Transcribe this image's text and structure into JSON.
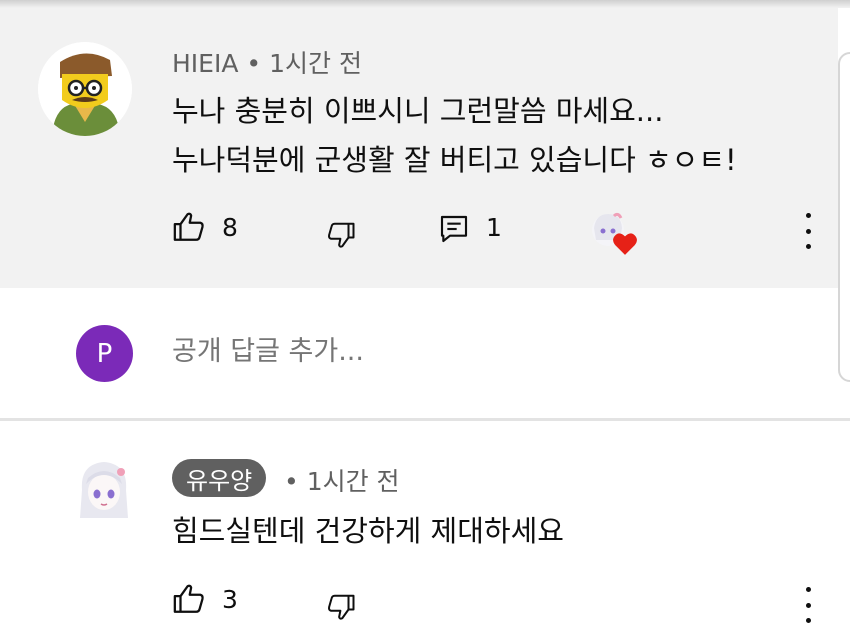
{
  "comments": [
    {
      "author": "HIEIA",
      "time": "• 1시간 전",
      "lines": [
        "누나 충분히 이쁘시니 그런말씀 마세요...",
        "누나덕분에 군생활 잘 버티고 있습니다 ㅎㅇㅌ!"
      ],
      "likes": "8",
      "replies": "1"
    },
    {
      "author": "유우양",
      "time": "• 1시간 전",
      "lines": [
        "힘드실텐데 건강하게 제대하세요"
      ],
      "likes": "3"
    }
  ],
  "reply_box": {
    "avatar_letter": "P",
    "placeholder": "공개 답글 추가..."
  },
  "icons": {
    "like": "thumbs-up-icon",
    "dislike": "thumbs-down-icon",
    "reply": "reply-comment-icon",
    "menu": "more-vert-icon",
    "creator_heart": "creator-heart-icon"
  },
  "colors": {
    "highlight_bg": "#f2f2f2",
    "secondary_text": "#606060",
    "avatar_purple": "#7b2ab8",
    "badge_bg": "#606060",
    "heart": "#e62117"
  }
}
